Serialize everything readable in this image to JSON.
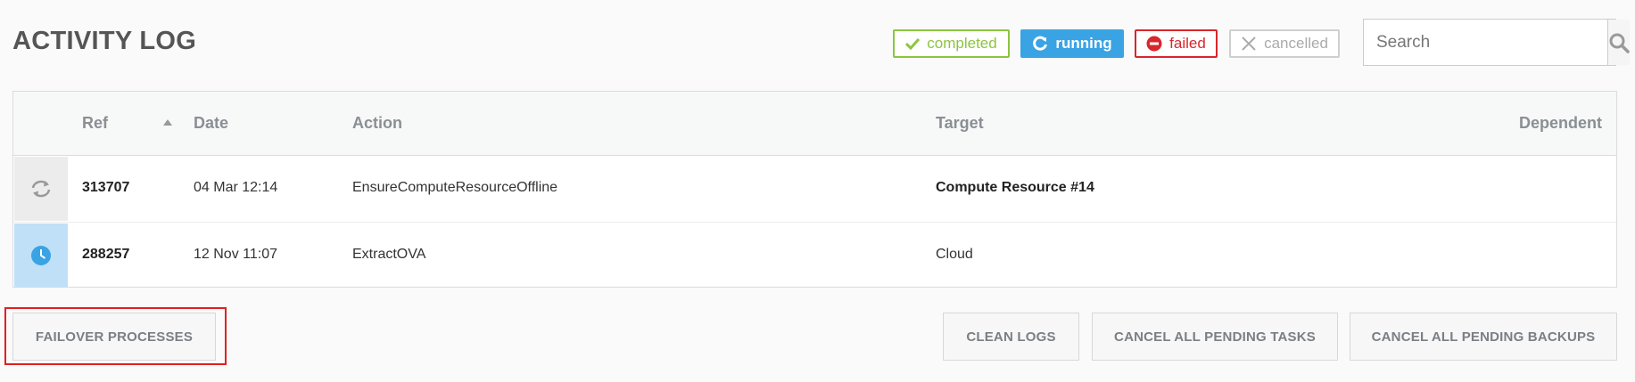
{
  "page": {
    "title": "ACTIVITY LOG"
  },
  "filters": [
    {
      "label": "completed",
      "icon": "check-icon",
      "color": "#8cc540"
    },
    {
      "label": "running",
      "icon": "refresh-icon",
      "color": "#3aa3e3"
    },
    {
      "label": "failed",
      "icon": "no-entry-icon",
      "color": "#d9262c"
    },
    {
      "label": "cancelled",
      "icon": "x-icon",
      "color": "#aaaaaa"
    }
  ],
  "search": {
    "placeholder": "Search",
    "value": "",
    "icon": "search-icon"
  },
  "table": {
    "columns": {
      "ref": "Ref",
      "date": "Date",
      "action": "Action",
      "target": "Target",
      "dependent": "Dependent"
    },
    "sort": {
      "column": "Ref",
      "direction": "ascending"
    },
    "rows": [
      {
        "status": "running",
        "status_icon": "refresh-icon",
        "ref": "313707",
        "date": "04 Mar 12:14",
        "action": "EnsureComputeResourceOffline",
        "target": "Compute Resource #14",
        "dependent": ""
      },
      {
        "status": "pending",
        "status_icon": "clock-icon",
        "ref": "288257",
        "date": "12 Nov 11:07",
        "action": "ExtractOVA",
        "target": "Cloud",
        "dependent": ""
      }
    ]
  },
  "actions": {
    "failover": "FAILOVER PROCESSES",
    "clean_logs": "CLEAN LOGS",
    "cancel_tasks": "CANCEL ALL PENDING TASKS",
    "cancel_backups": "CANCEL ALL PENDING BACKUPS"
  },
  "colors": {
    "highlight": "#e02020",
    "running_blue": "#3aa3e3",
    "pending_row": "#bfe0f7"
  }
}
